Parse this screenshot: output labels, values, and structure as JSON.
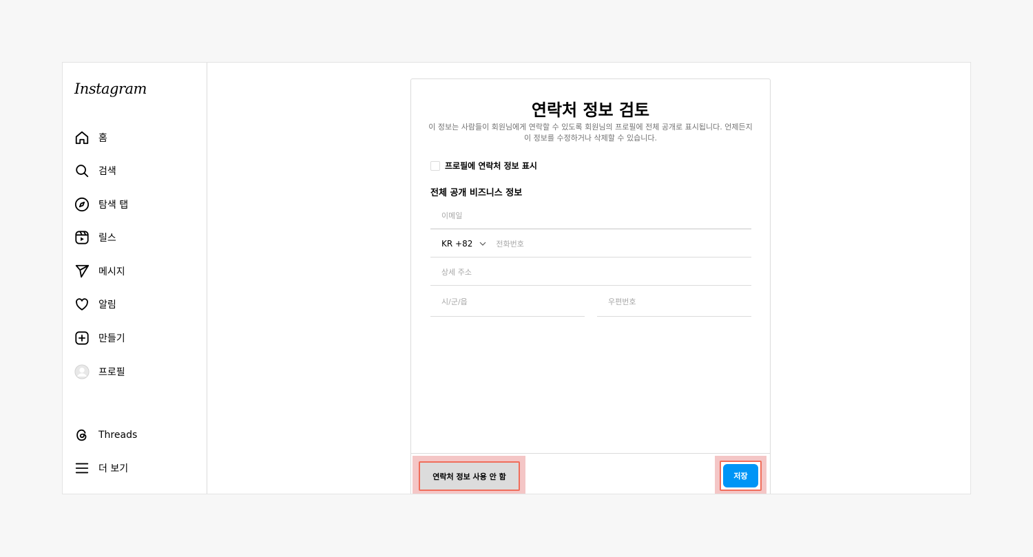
{
  "app": {
    "logo_text": "Instagram"
  },
  "sidebar": {
    "items": [
      {
        "label": "홈",
        "icon": "home-icon"
      },
      {
        "label": "검색",
        "icon": "search-icon"
      },
      {
        "label": "탐색 탭",
        "icon": "compass-icon"
      },
      {
        "label": "릴스",
        "icon": "reels-icon"
      },
      {
        "label": "메시지",
        "icon": "send-icon"
      },
      {
        "label": "알림",
        "icon": "heart-icon"
      },
      {
        "label": "만들기",
        "icon": "plus-square-icon"
      },
      {
        "label": "프로필",
        "icon": "avatar-icon"
      }
    ],
    "bottom_items": [
      {
        "label": "Threads",
        "icon": "threads-icon"
      },
      {
        "label": "더 보기",
        "icon": "menu-icon"
      }
    ]
  },
  "dialog": {
    "title": "연락처 정보 검토",
    "description": "이 정보는 사람들이 회원님에게 연락할 수 있도록 회원님의 프로필에 전체 공개로 표시됩니다. 언제든지 이 정보를 수정하거나 삭제할 수 있습니다.",
    "show_contact_checkbox": {
      "label": "프로필에 연락처 정보 표시",
      "checked": false
    },
    "section_title": "전체 공개 비즈니스 정보",
    "fields": {
      "email": {
        "placeholder": "이메일",
        "value": ""
      },
      "country_code": "KR +82",
      "phone": {
        "placeholder": "전화번호",
        "value": ""
      },
      "address": {
        "placeholder": "상세 주소",
        "value": ""
      },
      "city": {
        "placeholder": "시/군/읍",
        "value": ""
      },
      "zip": {
        "placeholder": "우편번호",
        "value": ""
      }
    },
    "buttons": {
      "dont_use": "연락처 정보 사용 안 함",
      "save": "저장"
    }
  },
  "colors": {
    "primary_button": "#0095f6",
    "highlight": "#f06d5b",
    "highlight_bg": "#f4c6c6"
  }
}
